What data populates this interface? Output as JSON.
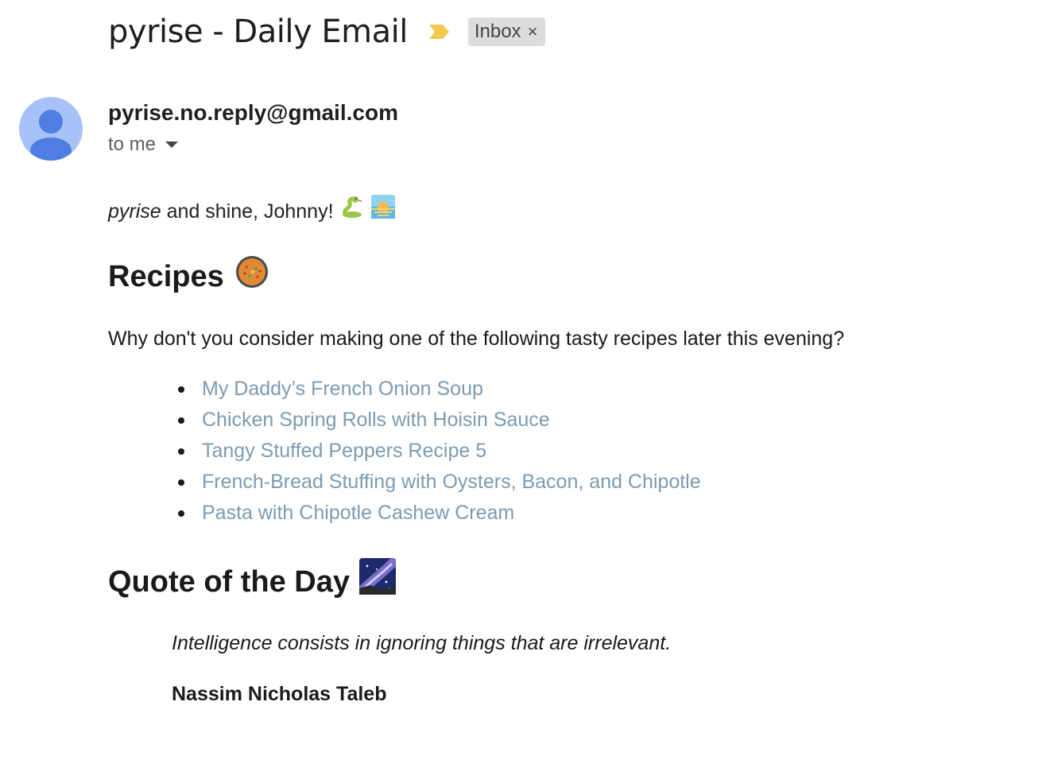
{
  "email": {
    "subject": "pyrise - Daily Email",
    "label": "Inbox",
    "label_close_glyph": "×",
    "importance_icon": "important-marker-icon",
    "sender": "pyrise.no.reply@gmail.com",
    "recipient_text": "to me"
  },
  "body": {
    "greeting_italic": "pyrise",
    "greeting_rest": " and shine, Johnny!",
    "greeting_icons": [
      "snake-emoji-icon",
      "sunrise-emoji-icon"
    ],
    "recipes": {
      "heading": "Recipes",
      "heading_icon": "paella-emoji-icon",
      "intro": "Why don't you consider making one of the following tasty recipes later this evening?",
      "items": [
        "My Daddy’s French Onion Soup",
        "Chicken Spring Rolls with Hoisin Sauce",
        "Tangy Stuffed Peppers Recipe 5",
        "French-Bread Stuffing with Oysters, Bacon, and Chipotle",
        "Pasta with Chipotle Cashew Cream"
      ]
    },
    "quote": {
      "heading": "Quote of the Day",
      "heading_icon": "milky-way-emoji-icon",
      "text": "Intelligence consists in ignoring things that are irrelevant.",
      "author": "Nassim Nicholas Taleb"
    }
  },
  "colors": {
    "link": "#7c9bb3",
    "avatar_bg": "#a8c1f7",
    "avatar_fg": "#4f7ee3",
    "importance": "#f2c94c",
    "chip_bg": "#dddddd"
  }
}
